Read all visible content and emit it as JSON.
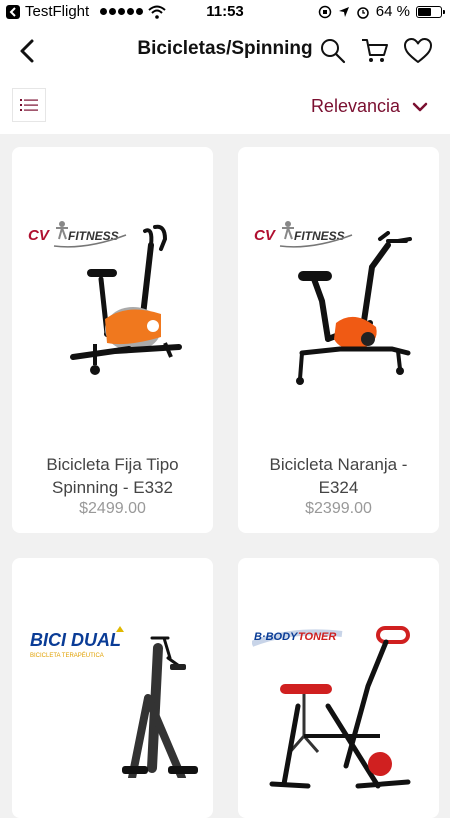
{
  "status_bar": {
    "carrier": "TestFlight",
    "time": "11:53",
    "battery": "64 %",
    "battery_level": 0.64
  },
  "header": {
    "title": "Bicicletas/Spinning",
    "back_icon": "chevron-left-icon",
    "search_icon": "search-icon",
    "cart_icon": "cart-icon",
    "favorites_icon": "heart-icon"
  },
  "filter": {
    "view_icon": "list-icon",
    "sort_label": "Relevancia",
    "sort_icon": "chevron-down-icon"
  },
  "products": [
    {
      "name": "Bicicleta Fija Tipo Spinning - E332",
      "price": "$2499.00",
      "brand": "CV FITNESS",
      "accent": "#f0781e"
    },
    {
      "name": "Bicicleta Naranja - E324",
      "price": "$2399.00",
      "brand": "CV FITNESS",
      "accent": "#f05a14"
    },
    {
      "name": "",
      "price": "",
      "brand": "BICI DUAL",
      "brand_sub": "BICICLETA TERAPÉUTICA",
      "accent": "#0a3c96"
    },
    {
      "name": "",
      "price": "",
      "brand": "B·BODY TONER",
      "accent": "#d02020"
    }
  ],
  "colors": {
    "accent": "#7a0f30",
    "background": "#f1f1f1"
  }
}
